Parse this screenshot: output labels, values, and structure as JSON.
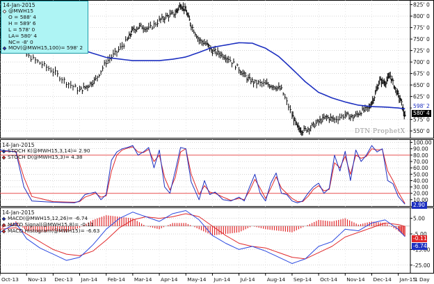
{
  "colors": {
    "price": "#000000",
    "moving_average": "#1c2fc0",
    "stoch_k": "#1c2fc0",
    "stoch_d": "#e0282a",
    "macd_line": "#2a48e0",
    "macd_signal": "#e0282a",
    "macd_histogram": "#e0282a",
    "band": "#e85050",
    "info_bg": "#aef4f4",
    "panel_border": "#000000"
  },
  "price_panel": {
    "info_rows": [
      {
        "icon": "date",
        "text": "14-Jan-2015"
      },
      {
        "icon": "open-diamond-icon",
        "text": "@MWH15"
      },
      {
        "icon": "",
        "text": "O = 588' 4"
      },
      {
        "icon": "",
        "text": "H = 589' 6"
      },
      {
        "icon": "",
        "text": "L = 578' 0"
      },
      {
        "icon": "",
        "text": "LA= 580' 4"
      },
      {
        "icon": "",
        "text": "NC= -8' 0"
      },
      {
        "icon": "blue-line-icon",
        "text": "MOV(@MWH15,100)= 598' 2"
      }
    ],
    "last_price_tag": "580' 4",
    "ma_tag": "598' 2",
    "watermark": "DTN ProphetX"
  },
  "stoch_panel": {
    "info_rows": [
      {
        "icon": "date",
        "text": "14-Jan-2015"
      },
      {
        "icon": "blue-diamond-icon",
        "text": "STOCH K(@MWH15,3,14)= 2.90"
      },
      {
        "icon": "red-diamond-icon",
        "text": "STOCH D(@MWH15,3)= 4.38"
      }
    ],
    "k_tag": "2.90"
  },
  "macd_panel": {
    "info_rows": [
      {
        "icon": "date",
        "text": "14-Jan-2015"
      },
      {
        "icon": "blue-diamond-icon",
        "text": "MACD(@MWH15,12,26)= -6.74"
      },
      {
        "icon": "red-diamond-icon",
        "text": "MACD Signal(@MWH15,8)= -0.11"
      },
      {
        "icon": "red-diamond-icon",
        "text": "MACD Histogram(@MWH15)= -6.63"
      }
    ],
    "signal_tag": "-0.11",
    "macd_tag": "-6.74"
  },
  "chart_data": [
    {
      "type": "line",
      "panel": "price",
      "y_ticks": [
        "825' 0",
        "800' 0",
        "775' 0",
        "750' 0",
        "725' 0",
        "700' 0",
        "675' 0",
        "650' 0",
        "625' 0",
        "600' 0",
        "575' 0",
        "550' 0"
      ],
      "ylim": [
        535,
        835
      ],
      "x_labels": [
        "Oct-13",
        "Nov-13",
        "Dec-13",
        "Jan-14",
        "Feb-14",
        "Mar-14",
        "Apr-14",
        "May-14",
        "Jun-14",
        "Jul-14",
        "Aug-14",
        "Sep-14",
        "Oct-14",
        "Nov-14",
        "Dec-14",
        "Jan-15"
      ],
      "xlim": [
        0,
        15.35
      ],
      "series": [
        {
          "name": "@MWH15",
          "style": "bars",
          "x": [
            0.0,
            0.5,
            1.0,
            1.5,
            2.0,
            2.5,
            3.0,
            3.3,
            3.6,
            4.0,
            4.4,
            4.8,
            5.0,
            5.3,
            5.6,
            6.0,
            6.3,
            6.6,
            6.8,
            7.0,
            7.2,
            7.5,
            7.8,
            8.0,
            8.3,
            8.6,
            9.0,
            9.3,
            9.6,
            10.0,
            10.3,
            10.6,
            11.0,
            11.2,
            11.4,
            11.7,
            12.0,
            12.3,
            12.6,
            13.0,
            13.3,
            13.6,
            13.9,
            14.1,
            14.3,
            14.5,
            14.7,
            14.9,
            15.1,
            15.25
          ],
          "values": [
            760,
            742,
            715,
            698,
            680,
            656,
            638,
            648,
            662,
            700,
            722,
            748,
            770,
            778,
            772,
            790,
            800,
            806,
            825,
            812,
            780,
            748,
            738,
            724,
            718,
            708,
            685,
            665,
            655,
            652,
            648,
            640,
            585,
            558,
            550,
            558,
            570,
            580,
            575,
            585,
            580,
            592,
            600,
            625,
            660,
            655,
            670,
            640,
            615,
            580
          ]
        },
        {
          "name": "MOV(@MWH15,100)",
          "style": "line",
          "x": [
            2.3,
            3.0,
            4.0,
            5.0,
            5.5,
            6.0,
            6.5,
            7.0,
            7.5,
            8.0,
            8.5,
            9.0,
            9.5,
            10.0,
            10.5,
            11.0,
            11.5,
            12.0,
            12.5,
            13.0,
            13.5,
            14.0,
            14.5,
            15.0,
            15.25
          ],
          "values": [
            744,
            728,
            710,
            703,
            703,
            703,
            706,
            711,
            721,
            732,
            737,
            742,
            741,
            730,
            712,
            685,
            657,
            634,
            622,
            613,
            606,
            603,
            602,
            600,
            598
          ]
        }
      ]
    },
    {
      "type": "line",
      "panel": "stochastic",
      "y_ticks": [
        "100.00",
        "90.00",
        "80.00",
        "70.00",
        "60.00",
        "50.00",
        "40.00",
        "30.00",
        "20.00",
        "10.00"
      ],
      "ylim": [
        0,
        105
      ],
      "reference_lines": [
        80,
        20
      ],
      "series": [
        {
          "name": "STOCH K(@MWH15,3,14)",
          "x": [
            0.0,
            0.6,
            0.9,
            1.2,
            2.0,
            2.8,
            3.0,
            3.2,
            3.6,
            3.8,
            4.0,
            4.2,
            4.4,
            4.6,
            4.8,
            5.0,
            5.2,
            5.4,
            5.6,
            5.8,
            6.0,
            6.2,
            6.4,
            6.6,
            6.8,
            7.0,
            7.2,
            7.5,
            7.7,
            7.9,
            8.1,
            8.4,
            8.7,
            9.0,
            9.2,
            9.4,
            9.6,
            9.8,
            10.0,
            10.2,
            10.4,
            10.6,
            10.8,
            11.0,
            11.2,
            11.4,
            11.6,
            11.8,
            12.0,
            12.2,
            12.4,
            12.6,
            12.8,
            13.0,
            13.2,
            13.4,
            13.6,
            13.8,
            14.0,
            14.2,
            14.4,
            14.6,
            14.8,
            15.0,
            15.25
          ],
          "values": [
            88,
            85,
            30,
            8,
            6,
            5,
            8,
            18,
            22,
            10,
            18,
            72,
            85,
            90,
            92,
            95,
            80,
            85,
            92,
            60,
            88,
            30,
            20,
            55,
            92,
            90,
            38,
            10,
            40,
            18,
            22,
            10,
            8,
            14,
            8,
            30,
            50,
            20,
            8,
            36,
            52,
            20,
            18,
            8,
            5,
            8,
            20,
            30,
            36,
            20,
            28,
            80,
            55,
            86,
            40,
            88,
            70,
            80,
            95,
            85,
            90,
            40,
            35,
            15,
            3
          ]
        },
        {
          "name": "STOCH D(@MWH15,3)",
          "x": [
            0.0,
            0.6,
            0.9,
            1.2,
            2.0,
            2.8,
            3.0,
            3.2,
            3.6,
            3.8,
            4.0,
            4.2,
            4.4,
            4.6,
            4.8,
            5.0,
            5.2,
            5.4,
            5.6,
            5.8,
            6.0,
            6.2,
            6.4,
            6.6,
            6.8,
            7.0,
            7.2,
            7.5,
            7.7,
            7.9,
            8.1,
            8.4,
            8.7,
            9.0,
            9.2,
            9.4,
            9.6,
            9.8,
            10.0,
            10.2,
            10.4,
            10.6,
            10.8,
            11.0,
            11.2,
            11.4,
            11.6,
            11.8,
            12.0,
            12.2,
            12.4,
            12.6,
            12.8,
            13.0,
            13.2,
            13.4,
            13.6,
            13.8,
            14.0,
            14.2,
            14.4,
            14.6,
            14.8,
            15.0,
            15.25
          ],
          "values": [
            86,
            86,
            45,
            15,
            7,
            6,
            7,
            14,
            20,
            14,
            16,
            55,
            80,
            88,
            91,
            93,
            85,
            84,
            89,
            70,
            80,
            45,
            25,
            45,
            85,
            90,
            50,
            18,
            32,
            22,
            20,
            14,
            9,
            12,
            10,
            24,
            42,
            28,
            12,
            28,
            46,
            28,
            20,
            12,
            7,
            7,
            15,
            26,
            32,
            24,
            26,
            68,
            60,
            78,
            50,
            80,
            75,
            78,
            90,
            88,
            89,
            55,
            40,
            22,
            4
          ]
        }
      ]
    },
    {
      "type": "line",
      "panel": "macd",
      "y_ticks": [
        "5.00",
        "-5.00",
        "-15.00",
        "-25.00"
      ],
      "ylim": [
        -30,
        12
      ],
      "series": [
        {
          "name": "MACD(@MWH15,12,26)",
          "x": [
            0.0,
            0.6,
            1.0,
            1.5,
            2.0,
            2.5,
            3.0,
            3.5,
            4.0,
            4.5,
            5.0,
            5.5,
            6.0,
            6.5,
            7.0,
            7.5,
            8.0,
            8.5,
            9.0,
            9.5,
            10.0,
            10.5,
            11.0,
            11.5,
            12.0,
            12.5,
            13.0,
            13.5,
            14.0,
            14.5,
            15.0,
            15.25
          ],
          "values": [
            -4,
            2,
            -8,
            -14,
            -18,
            -22,
            -20,
            -12,
            -2,
            5,
            9,
            6,
            3,
            8,
            10,
            4,
            -6,
            -11,
            -15,
            -13,
            -16,
            -20,
            -24,
            -21,
            -13,
            -10,
            -2,
            -3,
            2,
            4,
            -2,
            -6.74
          ]
        },
        {
          "name": "MACD Signal(@MWH15,8)",
          "x": [
            0.0,
            0.6,
            1.0,
            1.5,
            2.0,
            2.5,
            3.0,
            3.5,
            4.0,
            4.5,
            5.0,
            5.5,
            6.0,
            6.5,
            7.0,
            7.5,
            8.0,
            8.5,
            9.0,
            9.5,
            10.0,
            10.5,
            11.0,
            11.5,
            12.0,
            12.5,
            13.0,
            13.5,
            14.0,
            14.5,
            15.0,
            15.25
          ],
          "values": [
            -2,
            -1,
            -5,
            -10,
            -15,
            -18,
            -19,
            -16,
            -9,
            -1,
            4,
            6,
            5,
            6,
            8,
            6,
            0,
            -6,
            -11,
            -13,
            -14,
            -17,
            -20,
            -21,
            -17,
            -13,
            -7,
            -4,
            -1,
            2,
            1,
            -0.11
          ]
        },
        {
          "name": "MACD Histogram(@MWH15)",
          "style": "histogram",
          "x": [
            0.0,
            0.6,
            1.0,
            1.5,
            2.0,
            2.5,
            3.0,
            3.5,
            4.0,
            4.5,
            5.0,
            5.5,
            6.0,
            6.5,
            7.0,
            7.5,
            8.0,
            8.5,
            9.0,
            9.5,
            10.0,
            10.5,
            11.0,
            11.5,
            12.0,
            12.5,
            13.0,
            13.5,
            14.0,
            14.5,
            15.0,
            15.25
          ],
          "values": [
            -2,
            3,
            -3,
            -4,
            -3,
            -4,
            -1,
            4,
            7,
            6,
            5,
            0,
            -2,
            2,
            2,
            -2,
            -6,
            -5,
            -4,
            0,
            -2,
            -3,
            -4,
            0,
            4,
            3,
            5,
            1,
            3,
            2,
            -3,
            -6.63
          ]
        }
      ]
    }
  ]
}
